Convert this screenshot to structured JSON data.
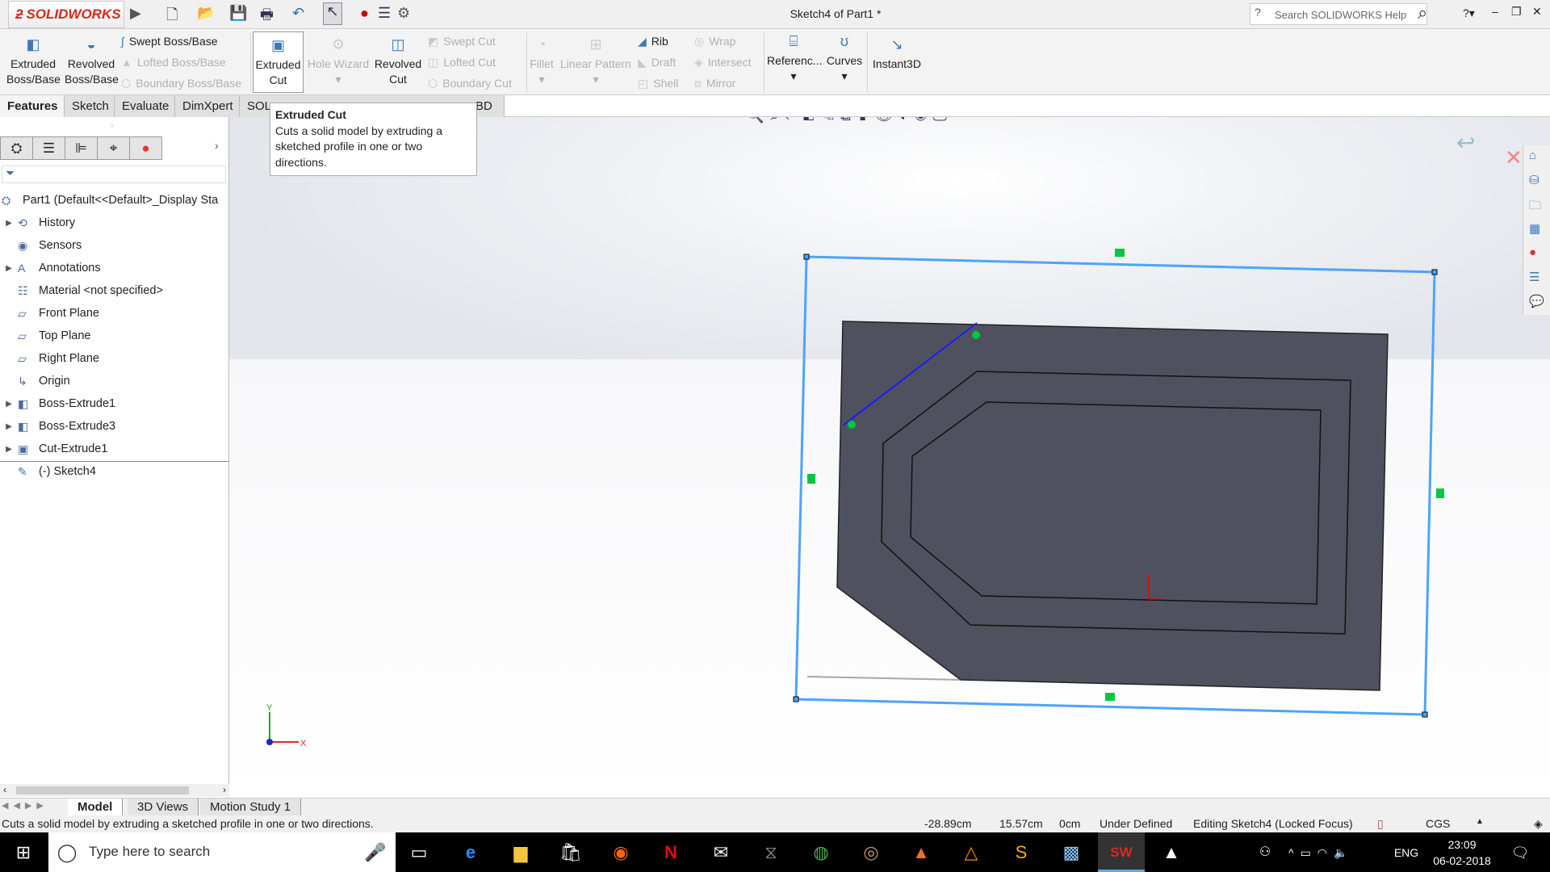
{
  "app": {
    "logo_text": "SOLIDWORKS",
    "title": "Sketch4 of Part1 *",
    "search_placeholder": "Search SOLIDWORKS Help"
  },
  "ribbon": {
    "large": [
      {
        "label": "Extruded\nBoss/Base"
      },
      {
        "label": "Revolved\nBoss/Base"
      },
      {
        "label": "Extruded\nCut"
      },
      {
        "label": "Hole Wizard"
      },
      {
        "label": "Revolved\nCut"
      },
      {
        "label": "Fillet"
      },
      {
        "label": "Linear Pattern"
      },
      {
        "label": "Referenc..."
      },
      {
        "label": "Curves"
      },
      {
        "label": "Instant3D"
      }
    ],
    "small": [
      {
        "label": "Swept Boss/Base"
      },
      {
        "label": "Lofted Boss/Base"
      },
      {
        "label": "Boundary Boss/Base"
      },
      {
        "label": "Swept Cut"
      },
      {
        "label": "Lofted Cut"
      },
      {
        "label": "Boundary Cut"
      },
      {
        "label": "Rib"
      },
      {
        "label": "Draft"
      },
      {
        "label": "Shell"
      },
      {
        "label": "Wrap"
      },
      {
        "label": "Intersect"
      },
      {
        "label": "Mirror"
      }
    ]
  },
  "tabs": [
    "Features",
    "Sketch",
    "Evaluate",
    "DimXpert",
    "SOL",
    "BD"
  ],
  "tooltip": {
    "title": "Extruded Cut",
    "body": "Cuts a solid model by extruding a sketched profile in one or two directions."
  },
  "tree": [
    {
      "label": "Part1  (Default<<Default>_Display Sta",
      "icon": "part-icon"
    },
    {
      "label": "History",
      "icon": "history-icon",
      "expand": true
    },
    {
      "label": "Sensors",
      "icon": "sensors-icon"
    },
    {
      "label": "Annotations",
      "icon": "annotations-icon",
      "expand": true
    },
    {
      "label": "Material <not specified>",
      "icon": "material-icon"
    },
    {
      "label": "Front Plane",
      "icon": "plane-icon"
    },
    {
      "label": "Top Plane",
      "icon": "plane-icon"
    },
    {
      "label": "Right Plane",
      "icon": "plane-icon"
    },
    {
      "label": "Origin",
      "icon": "origin-icon"
    },
    {
      "label": "Boss-Extrude1",
      "icon": "extrude-icon",
      "expand": true
    },
    {
      "label": "Boss-Extrude3",
      "icon": "extrude-icon",
      "expand": true
    },
    {
      "label": "Cut-Extrude1",
      "icon": "cut-icon",
      "expand": true
    },
    {
      "label": "(-) Sketch4",
      "icon": "sketch-icon"
    }
  ],
  "triad": {
    "x": "X",
    "y": "Y"
  },
  "bottom_tabs": [
    "Model",
    "3D Views",
    "Motion Study 1"
  ],
  "status": {
    "message": "Cuts a solid model by extruding a sketched profile in one or two directions.",
    "x": "-28.89cm",
    "y": "15.57cm",
    "z": "0cm",
    "state": "Under Defined",
    "editing": "Editing Sketch4 (Locked Focus)",
    "units": "CGS"
  },
  "taskbar": {
    "search_placeholder": "Type here to search",
    "lang": "ENG",
    "time": "23:09",
    "date": "06-02-2018"
  },
  "colors": {
    "sketch": "#4da3ff",
    "model": "#4f525e",
    "handle": "#00c83c",
    "brand": "#d52b1e"
  }
}
